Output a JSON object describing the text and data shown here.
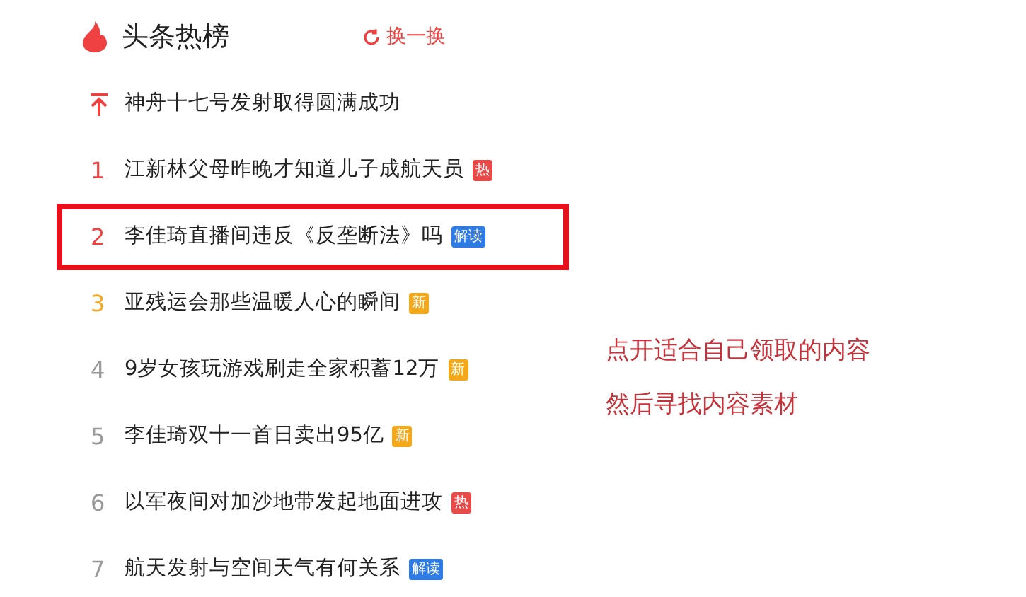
{
  "header": {
    "title": "头条热榜",
    "refresh": "换一换"
  },
  "items": [
    {
      "kind": "pinned",
      "title": "神舟十七号发射取得圆满成功",
      "highlighted": false
    },
    {
      "kind": "ranked",
      "rank": "1",
      "color": "#f04142",
      "title": "江新林父母昨晚才知道儿子成航天员",
      "badge": {
        "kind": "hot",
        "text": "热"
      },
      "highlighted": false
    },
    {
      "kind": "ranked",
      "rank": "2",
      "color": "#f04142",
      "title": "李佳琦直播间违反《反垄断法》吗",
      "badge": {
        "kind": "explain",
        "text": "解读"
      },
      "highlighted": true
    },
    {
      "kind": "ranked",
      "rank": "3",
      "color": "#f5a623",
      "title": "亚残运会那些温暖人心的瞬间",
      "badge": {
        "kind": "new",
        "text": "新"
      },
      "highlighted": false
    },
    {
      "kind": "ranked",
      "rank": "4",
      "color": "#999999",
      "title": "9岁女孩玩游戏刷走全家积蓄12万",
      "badge": {
        "kind": "new",
        "text": "新"
      },
      "highlighted": false
    },
    {
      "kind": "ranked",
      "rank": "5",
      "color": "#999999",
      "title": "李佳琦双十一首日卖出95亿",
      "badge": {
        "kind": "new",
        "text": "新"
      },
      "highlighted": false
    },
    {
      "kind": "ranked",
      "rank": "6",
      "color": "#999999",
      "title": "以军夜间对加沙地带发起地面进攻",
      "badge": {
        "kind": "hot",
        "text": "热"
      },
      "highlighted": false
    },
    {
      "kind": "ranked",
      "rank": "7",
      "color": "#999999",
      "title": "航天发射与空间天气有何关系",
      "badge": {
        "kind": "explain",
        "text": "解读"
      },
      "highlighted": false
    }
  ],
  "annotation": [
    "点开适合自己领取的内容",
    "然后寻找内容素材"
  ]
}
